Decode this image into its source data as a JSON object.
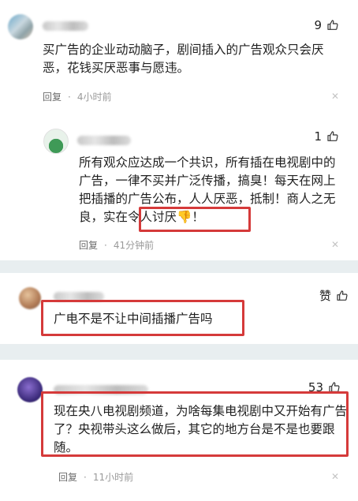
{
  "comment1": {
    "likes": "9",
    "text": "买广告的企业动动脑子，剧间插入的广告观众只会厌恶，花钱买厌恶事与愿违。",
    "reply_label": "回复",
    "time": "4小时前"
  },
  "reply1": {
    "likes": "1",
    "text_main": "所有观众应达成一个共识，所有插在电视剧中的广告，一律不买并广泛传播，搞臭！每天在网上把插播的广告公布，人人厌恶，抵制！商人之无良，",
    "text_highlight": "实在令人讨厌",
    "text_end": "！",
    "reply_label": "回复",
    "time": "41分钟前"
  },
  "comment2": {
    "likes": "赞",
    "text": "广电不是不让中间插播广告吗"
  },
  "comment3": {
    "likes": "53",
    "text": "现在央八电视剧频道，为啥每集电视剧中又开始有广告了？央视带头这么做后，其它的地方台是不是也要跟随。",
    "reply_label": "回复",
    "time": "11小时前"
  },
  "colors": {
    "highlight": "#d53a3a",
    "separator": "#e8eef0"
  },
  "icons": {
    "like": "thumbs-up-icon",
    "close": "close-icon",
    "emoji": "thumbs-down-emoji"
  }
}
